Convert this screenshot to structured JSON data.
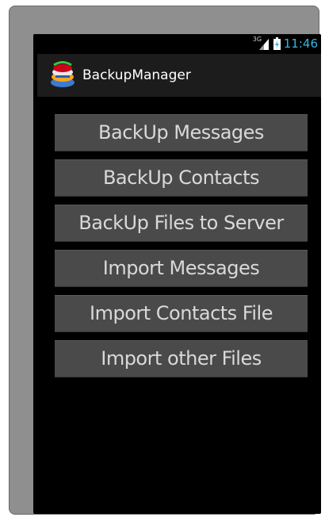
{
  "status_bar": {
    "network_type": "3G",
    "time": "11:46",
    "time_color": "#33b5e5",
    "icons": [
      "signal-icon",
      "battery-icon"
    ]
  },
  "action_bar": {
    "app_icon": "backup-manager-app-icon",
    "title": "BackupManager"
  },
  "buttons": [
    {
      "label": "BackUp Messages"
    },
    {
      "label": "BackUp Contacts"
    },
    {
      "label": "BackUp Files to Server"
    },
    {
      "label": "Import Messages"
    },
    {
      "label": "Import Contacts File"
    },
    {
      "label": "Import other Files"
    }
  ],
  "colors": {
    "screen_background": "#000000",
    "action_bar_background": "#1c1c1c",
    "button_background": "#4a4a4a",
    "button_text": "#d9d9d9",
    "frame": "#8f8f8f"
  }
}
